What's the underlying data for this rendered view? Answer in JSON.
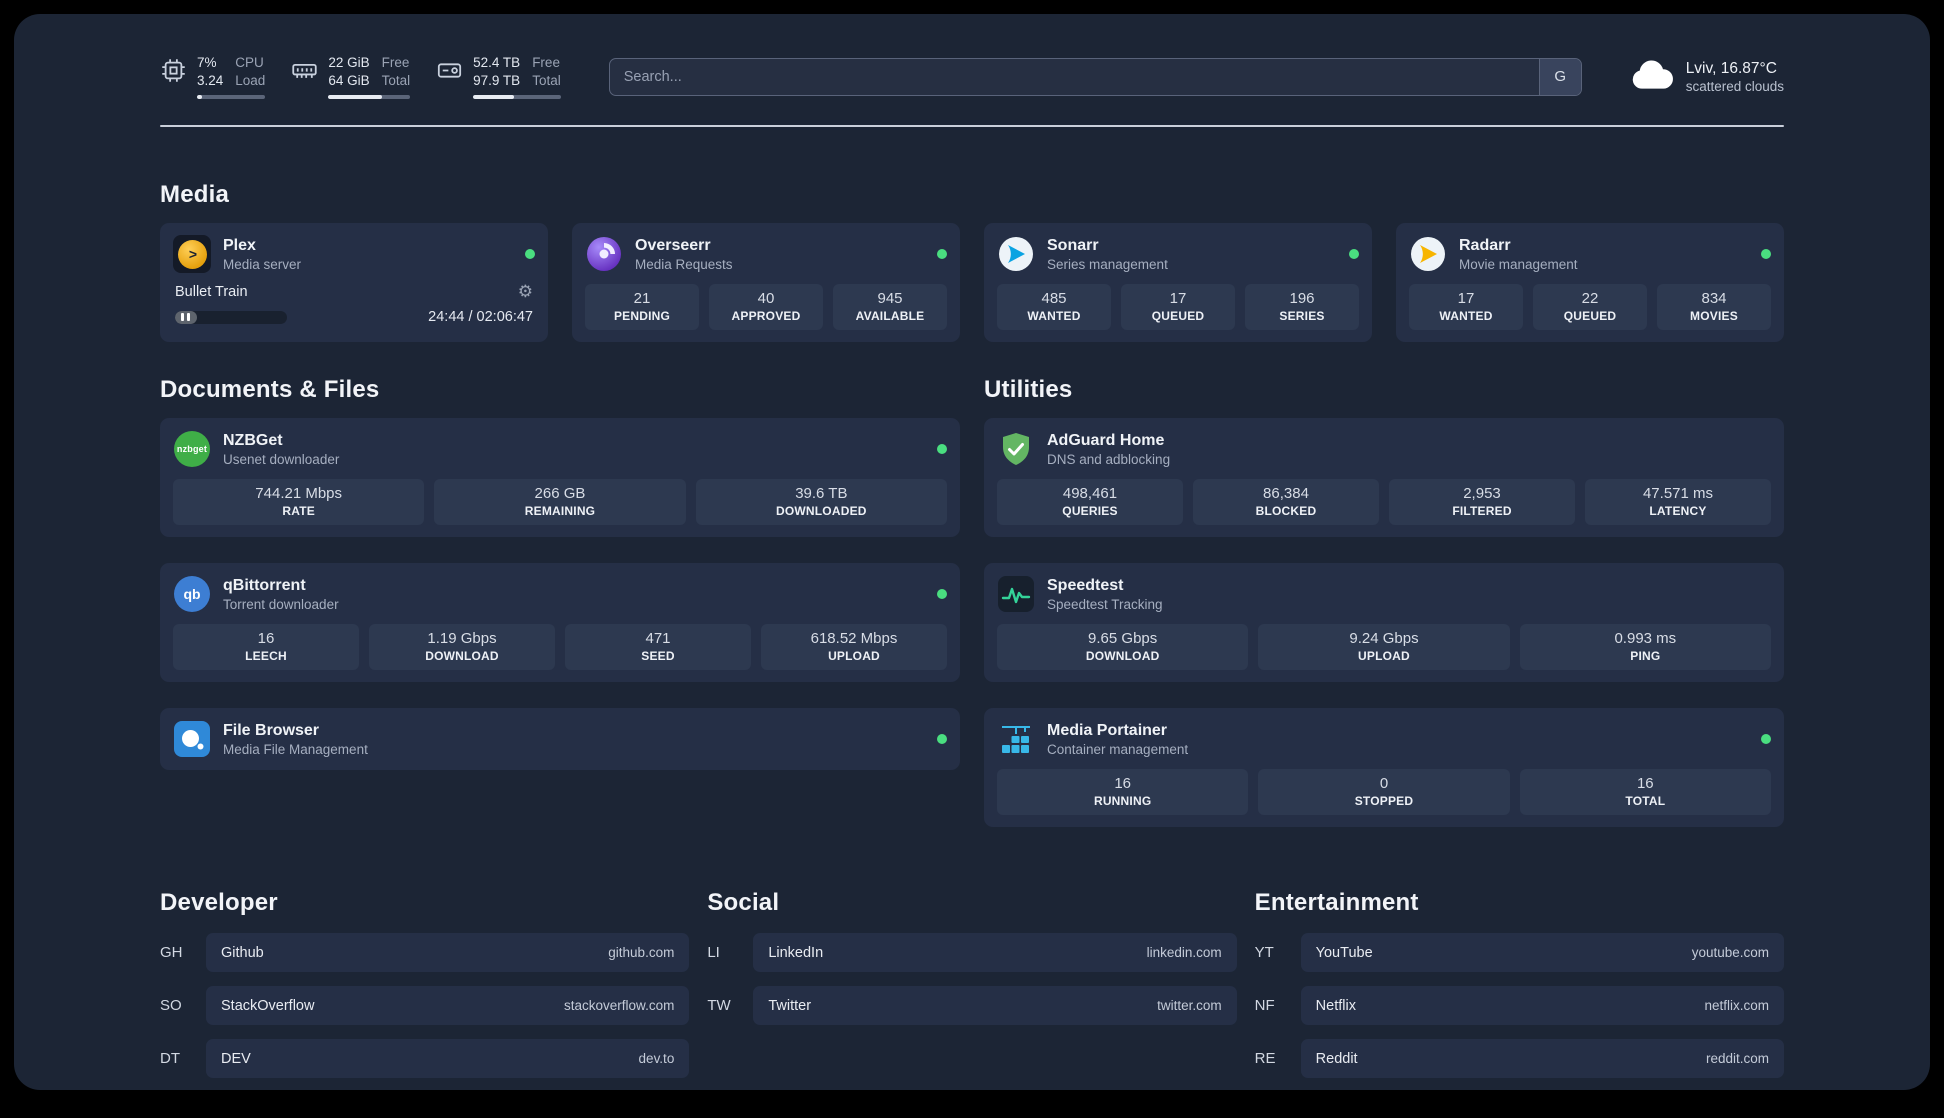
{
  "topbar": {
    "cpu": {
      "percent": "7%",
      "load": "3.24",
      "label_top": "CPU",
      "label_bottom": "Load",
      "progress_pct": 7
    },
    "memory": {
      "free": "22 GiB",
      "total": "64 GiB",
      "label_top": "Free",
      "label_bottom": "Total",
      "progress_pct": 66
    },
    "disk": {
      "free": "52.4 TB",
      "total": "97.9 TB",
      "label_top": "Free",
      "label_bottom": "Total",
      "progress_pct": 47
    },
    "search": {
      "placeholder": "Search...",
      "provider_button": "G"
    },
    "weather": {
      "location": "Lviv, 16.87°C",
      "condition": "scattered clouds"
    }
  },
  "sections": {
    "media": {
      "title": "Media",
      "plex": {
        "name": "Plex",
        "subtitle": "Media server",
        "now_playing": {
          "title": "Bullet Train",
          "time": "24:44 / 02:06:47",
          "progress_pct": 20
        }
      },
      "overseerr": {
        "name": "Overseerr",
        "subtitle": "Media Requests",
        "stats": [
          {
            "value": "21",
            "label": "PENDING"
          },
          {
            "value": "40",
            "label": "APPROVED"
          },
          {
            "value": "945",
            "label": "AVAILABLE"
          }
        ]
      },
      "sonarr": {
        "name": "Sonarr",
        "subtitle": "Series management",
        "stats": [
          {
            "value": "485",
            "label": "WANTED"
          },
          {
            "value": "17",
            "label": "QUEUED"
          },
          {
            "value": "196",
            "label": "SERIES"
          }
        ]
      },
      "radarr": {
        "name": "Radarr",
        "subtitle": "Movie management",
        "stats": [
          {
            "value": "17",
            "label": "WANTED"
          },
          {
            "value": "22",
            "label": "QUEUED"
          },
          {
            "value": "834",
            "label": "MOVIES"
          }
        ]
      }
    },
    "documents": {
      "title": "Documents & Files",
      "nzbget": {
        "name": "NZBGet",
        "subtitle": "Usenet downloader",
        "stats": [
          {
            "value": "744.21 Mbps",
            "label": "RATE"
          },
          {
            "value": "266 GB",
            "label": "REMAINING"
          },
          {
            "value": "39.6 TB",
            "label": "DOWNLOADED"
          }
        ]
      },
      "qbittorrent": {
        "name": "qBittorrent",
        "subtitle": "Torrent downloader",
        "stats": [
          {
            "value": "16",
            "label": "LEECH"
          },
          {
            "value": "1.19 Gbps",
            "label": "DOWNLOAD"
          },
          {
            "value": "471",
            "label": "SEED"
          },
          {
            "value": "618.52 Mbps",
            "label": "UPLOAD"
          }
        ]
      },
      "filebrowser": {
        "name": "File Browser",
        "subtitle": "Media File Management"
      }
    },
    "utilities": {
      "title": "Utilities",
      "adguard": {
        "name": "AdGuard Home",
        "subtitle": "DNS and adblocking",
        "stats": [
          {
            "value": "498,461",
            "label": "QUERIES"
          },
          {
            "value": "86,384",
            "label": "BLOCKED"
          },
          {
            "value": "2,953",
            "label": "FILTERED"
          },
          {
            "value": "47.571 ms",
            "label": "LATENCY"
          }
        ]
      },
      "speedtest": {
        "name": "Speedtest",
        "subtitle": "Speedtest Tracking",
        "stats": [
          {
            "value": "9.65 Gbps",
            "label": "DOWNLOAD"
          },
          {
            "value": "9.24 Gbps",
            "label": "UPLOAD"
          },
          {
            "value": "0.993 ms",
            "label": "PING"
          }
        ]
      },
      "portainer": {
        "name": "Media Portainer",
        "subtitle": "Container management",
        "stats": [
          {
            "value": "16",
            "label": "RUNNING"
          },
          {
            "value": "0",
            "label": "STOPPED"
          },
          {
            "value": "16",
            "label": "TOTAL"
          }
        ]
      }
    },
    "bookmarks": {
      "developer": {
        "title": "Developer",
        "items": [
          {
            "abbr": "GH",
            "name": "Github",
            "url": "github.com"
          },
          {
            "abbr": "SO",
            "name": "StackOverflow",
            "url": "stackoverflow.com"
          },
          {
            "abbr": "DT",
            "name": "DEV",
            "url": "dev.to"
          }
        ]
      },
      "social": {
        "title": "Social",
        "items": [
          {
            "abbr": "LI",
            "name": "LinkedIn",
            "url": "linkedin.com"
          },
          {
            "abbr": "TW",
            "name": "Twitter",
            "url": "twitter.com"
          }
        ]
      },
      "entertainment": {
        "title": "Entertainment",
        "items": [
          {
            "abbr": "YT",
            "name": "YouTube",
            "url": "youtube.com"
          },
          {
            "abbr": "NF",
            "name": "Netflix",
            "url": "netflix.com"
          },
          {
            "abbr": "RE",
            "name": "Reddit",
            "url": "reddit.com"
          }
        ]
      }
    }
  },
  "icons": {
    "plex_arrow": ">",
    "gear": "⚙",
    "nzbget": "nzbget",
    "qbittorrent": "qb"
  },
  "colors": {
    "status_online": "#4ade80",
    "plex_accent": "#e5a00d",
    "background": "#1c2535",
    "card": "#252f46"
  }
}
